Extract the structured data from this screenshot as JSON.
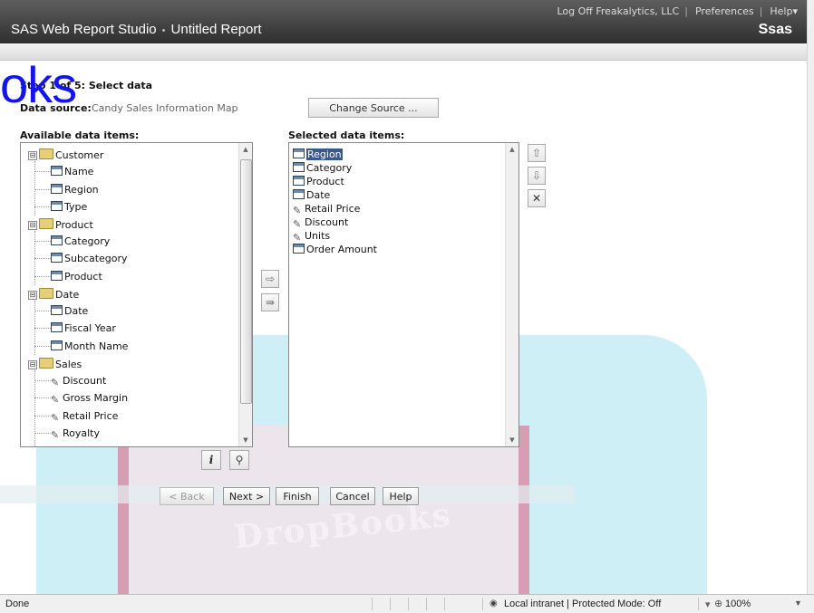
{
  "header": {
    "app_name": "SAS Web Report Studio",
    "separator": "•",
    "report_name": "Untitled Report",
    "logoff": "Log Off Freakalytics, LLC",
    "preferences": "Preferences",
    "help": "Help▾",
    "logo": "Ssas"
  },
  "watermark": {
    "big_text": "oks",
    "book_text": "DropBooks"
  },
  "wizard": {
    "step": "Step 1 of 5: Select data",
    "data_source_label": "Data source:",
    "data_source_value": "Candy Sales Information Map",
    "change_source": "Change Source ...",
    "available_heading": "Available data items:",
    "selected_heading": "Selected data items:"
  },
  "available": {
    "customer": "Customer",
    "name": "Name",
    "region": "Region",
    "type": "Type",
    "product_folder": "Product",
    "category": "Category",
    "subcategory": "Subcategory",
    "product": "Product",
    "date_folder": "Date",
    "date": "Date",
    "fiscal_year": "Fiscal Year",
    "month_name": "Month Name",
    "sales": "Sales",
    "discount": "Discount",
    "gross_margin": "Gross Margin",
    "retail_price": "Retail Price",
    "royalty": "Royalty"
  },
  "selected": [
    {
      "label": "Region",
      "kind": "category",
      "highlighted": true
    },
    {
      "label": "Category",
      "kind": "category"
    },
    {
      "label": "Product",
      "kind": "category"
    },
    {
      "label": "Date",
      "kind": "category"
    },
    {
      "label": "Retail Price",
      "kind": "measure"
    },
    {
      "label": "Discount",
      "kind": "measure"
    },
    {
      "label": "Units",
      "kind": "measure"
    },
    {
      "label": "Order Amount",
      "kind": "category"
    }
  ],
  "icons": {
    "expanded": "⊟",
    "add": "⇨",
    "add_all": "⇛",
    "up": "⇧",
    "down": "⇩",
    "remove": "✕",
    "info": "i",
    "search": "⚲"
  },
  "buttons": {
    "back": "< Back",
    "next": "Next >",
    "finish": "Finish",
    "cancel": "Cancel",
    "help": "Help"
  },
  "statusbar": {
    "done": "Done",
    "zone": "Local intranet | Protected Mode: Off",
    "zoom": "100%"
  }
}
